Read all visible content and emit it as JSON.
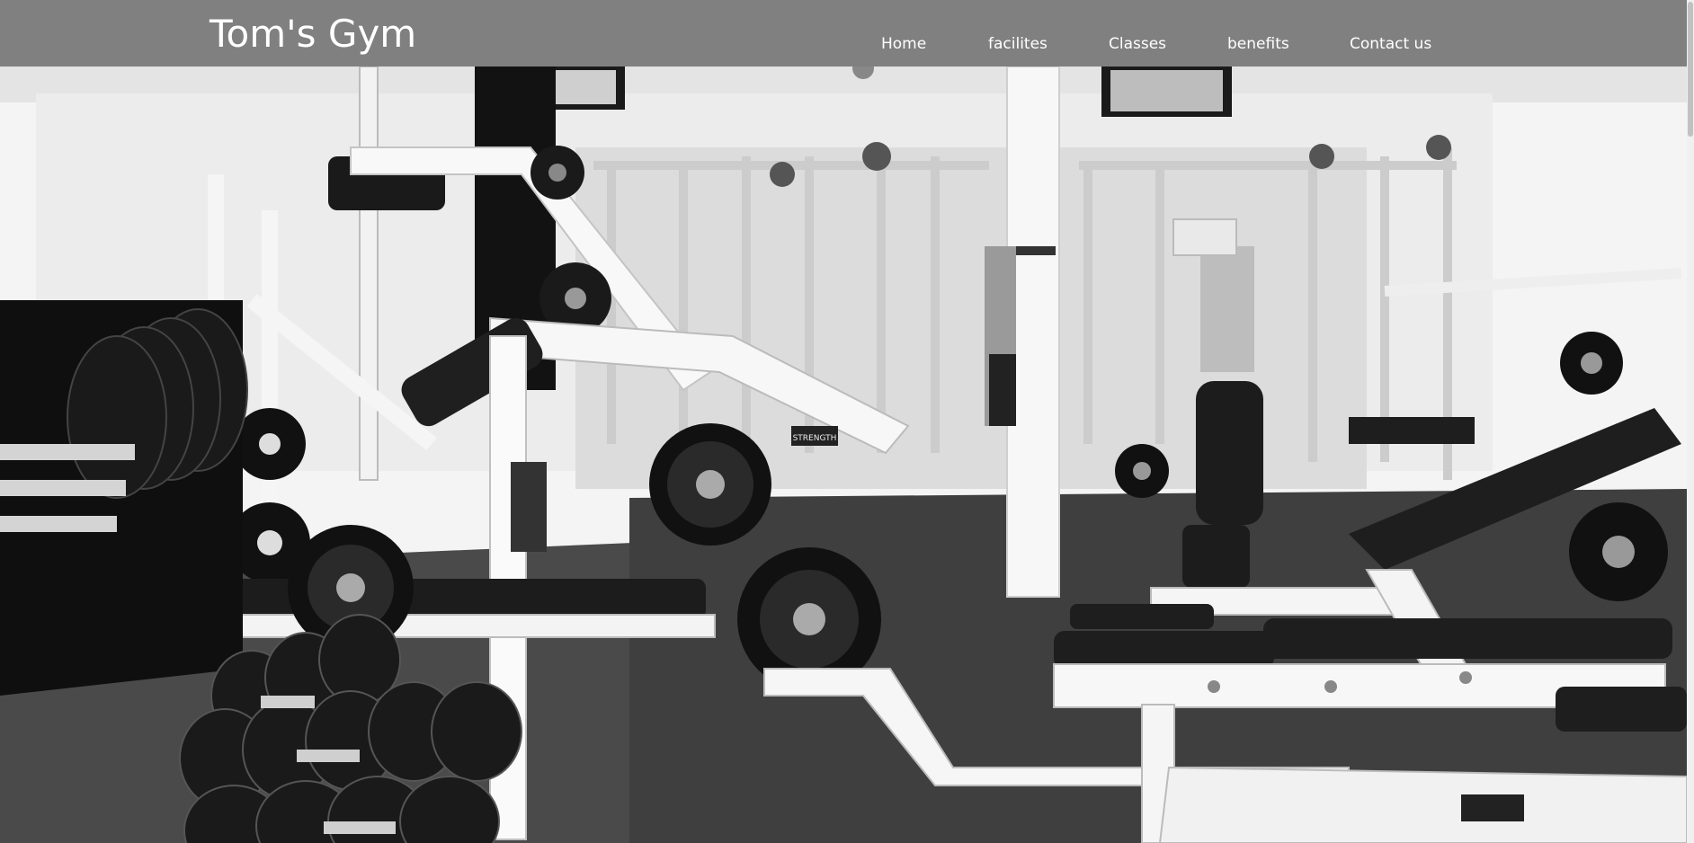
{
  "brand": {
    "title": "Tom's Gym"
  },
  "nav": {
    "items": [
      {
        "label": "Home"
      },
      {
        "label": "facilites"
      },
      {
        "label": "Classes"
      },
      {
        "label": "benefits"
      },
      {
        "label": "Contact us"
      }
    ]
  },
  "hero": {
    "description": "gym-equipment-photo",
    "machine_label": "STRENGTH"
  },
  "colors": {
    "navbar_bg": "#808080",
    "nav_text": "#ffffff"
  }
}
